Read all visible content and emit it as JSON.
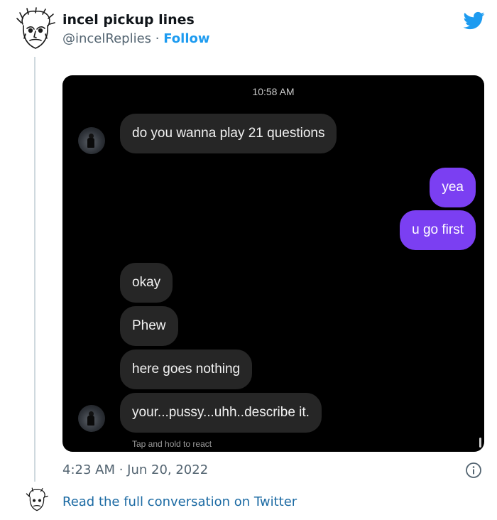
{
  "tweet": {
    "author_name": "incel pickup lines",
    "handle": "@incelReplies",
    "separator": " · ",
    "follow_label": "Follow",
    "timestamp": "4:23 AM · Jun 20, 2022",
    "read_link": "Read the full conversation on Twitter",
    "icons": {
      "brand": "twitter-bird-icon",
      "info": "info-icon"
    },
    "colors": {
      "link": "#1d9bf0",
      "muted": "#536471"
    }
  },
  "conversation": {
    "time": "10:58 AM",
    "messages": [
      {
        "side": "in",
        "text": "do you wanna play 21 questions"
      },
      {
        "side": "out",
        "text": "yea"
      },
      {
        "side": "out",
        "text": "u go first"
      },
      {
        "side": "in",
        "text": "okay"
      },
      {
        "side": "in",
        "text": "Phew"
      },
      {
        "side": "in",
        "text": "here goes nothing"
      },
      {
        "side": "in",
        "text": "your...pussy...uhh..describe it."
      }
    ],
    "hint": "Tap and hold to react",
    "colors": {
      "incoming": "#262626",
      "outgoing": "#7b3ff2",
      "background": "#000000"
    }
  }
}
